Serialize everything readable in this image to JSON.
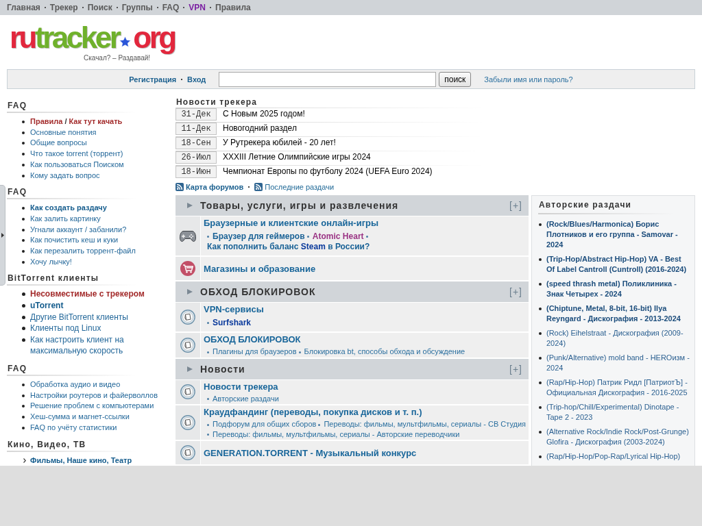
{
  "nav": {
    "items": [
      {
        "label": "Главная",
        "kind": "normal"
      },
      {
        "label": "Трекер",
        "kind": "normal"
      },
      {
        "label": "Поиск",
        "kind": "normal"
      },
      {
        "label": "Группы",
        "kind": "normal"
      },
      {
        "label": "FAQ",
        "kind": "normal"
      },
      {
        "label": "VPN",
        "kind": "accent"
      },
      {
        "label": "Правила",
        "kind": "normal"
      }
    ]
  },
  "logo": {
    "parts": [
      {
        "text": "ru",
        "color": "#e2273d"
      },
      {
        "text": "tracker",
        "color": "#6fb12b"
      }
    ],
    "domain": "org",
    "tagline": "Скачал? – Раздавай!"
  },
  "login_bar": {
    "links": [
      "Регистрация",
      "Вход"
    ],
    "search_button": "поиск",
    "forgot_link": "Забыли имя или пароль?"
  },
  "sidebar": {
    "sections": [
      {
        "title": "FAQ",
        "kind": "list",
        "items": [
          {
            "kind": "important_pair",
            "links": [
              "Правила",
              "Как тут качать"
            ],
            "separator": "/"
          },
          {
            "kind": "normal",
            "text": "Основные понятия"
          },
          {
            "kind": "normal",
            "text": "Общие вопросы"
          },
          {
            "kind": "normal",
            "text": "Что такое torrent (торрент)"
          },
          {
            "kind": "normal",
            "text": "Как пользоваться Поиском"
          },
          {
            "kind": "normal",
            "text": "Кому задать вопрос"
          }
        ]
      },
      {
        "title": "FAQ",
        "kind": "list",
        "items": [
          {
            "kind": "bold",
            "text": "Как создать раздачу"
          },
          {
            "kind": "normal",
            "text": "Как залить картинку"
          },
          {
            "kind": "normal",
            "text": "Угнали аккаунт / забанили?"
          },
          {
            "kind": "normal",
            "text": "Как почистить кеш и куки"
          },
          {
            "kind": "normal",
            "text": "Как перезалить торрент-файл"
          },
          {
            "kind": "normal",
            "text": "Хочу лычку!"
          }
        ]
      },
      {
        "title": "BitTorrent клиенты",
        "kind": "large_list",
        "items": [
          {
            "kind": "important",
            "text": "Несовместимые с трекером"
          },
          {
            "kind": "bold",
            "text": "uTorrent"
          },
          {
            "kind": "normal",
            "text": "Другие BitTorrent клиенты"
          },
          {
            "kind": "normal",
            "text": "Клиенты под Linux"
          },
          {
            "kind": "normal",
            "text": "Как настроить клиент на максимальную скорость"
          }
        ]
      },
      {
        "title": "FAQ",
        "kind": "list",
        "items": [
          {
            "kind": "normal",
            "text": "Обработка аудио и видео"
          },
          {
            "kind": "normal",
            "text": "Настройки роутеров и файерволлов"
          },
          {
            "kind": "normal",
            "text": "Решение проблем с компьютерами"
          },
          {
            "kind": "normal",
            "text": "Хеш-сумма и магнет-ссылки"
          },
          {
            "kind": "normal",
            "text": "FAQ по учёту статистики"
          }
        ]
      },
      {
        "title": "Кино, Видео, ТВ",
        "kind": "chevron_list",
        "items": [
          {
            "kind": "bold",
            "text": "Фильмы, Наше кино, Театр"
          }
        ]
      }
    ]
  },
  "news": {
    "title": "Новости трекера",
    "items": [
      {
        "date": "31-Дек",
        "title": "С Новым 2025 годом!"
      },
      {
        "date": "11-Дек",
        "title": "Новогодний раздел"
      },
      {
        "date": "18-Сен",
        "title": "У Рутрекера юбилей - 20 лет!"
      },
      {
        "date": "26-Июл",
        "title": "XXXIII Летние Олимпийские игры 2024"
      },
      {
        "date": "18-Июн",
        "title": "Чемпионат Европы по футболу 2024 (UEFA Euro 2024)"
      }
    ]
  },
  "feed_links": [
    {
      "text": "Карта форумов",
      "kind": "bold"
    },
    {
      "text": "Последние раздачи",
      "kind": "normal"
    }
  ],
  "forum": {
    "categories": [
      {
        "title": "Товары, услуги, игры и развлечения",
        "expand_label": "[+]",
        "forums": [
          {
            "kind": "gamepad",
            "title": "Браузерные и клиентские онлайн-игры",
            "subforums": [
              {
                "kind": "bold",
                "parts": [
                  {
                    "text": "Браузер для геймеров"
                  }
                ]
              },
              {
                "kind": "bold",
                "parts": [
                  {
                    "text": "Atomic Heart",
                    "color": "#9b3585"
                  }
                ]
              },
              {
                "kind": "bold",
                "parts": [
                  {
                    "text": "Как пополнить баланс "
                  },
                  {
                    "text": "Steam",
                    "color": "#0a3a9c"
                  },
                  {
                    "text": " в России?"
                  }
                ]
              }
            ]
          },
          {
            "kind": "cart",
            "title": "Магазины и образование"
          }
        ]
      },
      {
        "title": "ОБХОД БЛОКИРОВОК",
        "expand_label": "[+]",
        "forums": [
          {
            "kind": "forum",
            "title": "VPN-сервисы",
            "subforums": [
              {
                "kind": "bold",
                "parts": [
                  {
                    "text": "Surfshark",
                    "color": "#0a3a9c"
                  }
                ]
              }
            ]
          },
          {
            "kind": "forum",
            "title": "ОБХОД БЛОКИРОВОК",
            "subforums": [
              {
                "kind": "normal",
                "parts": [
                  {
                    "text": "Плагины для браузеров"
                  }
                ]
              },
              {
                "kind": "normal",
                "parts": [
                  {
                    "text": "Блокировка bt, способы обхода и обсуждение"
                  }
                ]
              }
            ]
          }
        ]
      },
      {
        "title": "Новости",
        "expand_label": "[+]",
        "forums": [
          {
            "kind": "forum",
            "title": "Новости трекера",
            "subforums": [
              {
                "kind": "normal",
                "parts": [
                  {
                    "text": "Авторские раздачи"
                  }
                ]
              }
            ]
          },
          {
            "kind": "forum",
            "title": "Краудфандинг (переводы, покупка дисков и т. п.)",
            "subforums": [
              {
                "kind": "normal",
                "parts": [
                  {
                    "text": "Подфорум для общих сборов"
                  }
                ]
              },
              {
                "kind": "normal",
                "parts": [
                  {
                    "text": "Переводы: фильмы, мультфильмы, сериалы - СВ Студия"
                  }
                ]
              },
              {
                "kind": "normal",
                "parts": [
                  {
                    "text": "Переводы: фильмы, мультфильмы, сериалы - Авторские переводчики"
                  }
                ]
              }
            ]
          },
          {
            "kind": "forum",
            "title": "GENERATION.TORRENT - Музыкальный конкурс"
          }
        ]
      }
    ]
  },
  "authors": {
    "title": "Авторские раздачи",
    "items": [
      {
        "text": "(Rock/Blues/Harmonica) Борис Плотников и его группа - Samovar - 2024",
        "kind": "bold"
      },
      {
        "text": "(Trip-Hop/Abstract Hip-Hop) VA - Best Of Label Cantroll (Cuntroll) (2016-2024)",
        "kind": "bold"
      },
      {
        "text": "(speed thrash metal) Поликлиника - Знак Четырех - 2024",
        "kind": "bold"
      },
      {
        "text": "(Chiptune, Metal, 8-bit, 16-bit) Ilya Reyngard - Дискография - 2013-2024",
        "kind": "bold"
      },
      {
        "text": "(Rock) Eihelstraat - Дискография (2009-2024)",
        "kind": "normal"
      },
      {
        "text": "(Punk/Alternative) mold band - HEROизм - 2024",
        "kind": "normal"
      },
      {
        "text": "(Rap/Hip-Hop) Патрик Ридл [ПатриотЪ] - Официальная Дискография - 2016-2025",
        "kind": "normal"
      },
      {
        "text": "(Trip-hop/Chill/Experimental) Dinotape - Tape 2 - 2023",
        "kind": "normal"
      },
      {
        "text": "(Alternative Rock/Indie Rock/Post-Grunge) Glofira - Дискография (2003-2024)",
        "kind": "normal"
      },
      {
        "text": "(Rap/Hip-Hop/Pop-Rap/Lyrical Hip-Hop)",
        "kind": "normal"
      }
    ]
  }
}
